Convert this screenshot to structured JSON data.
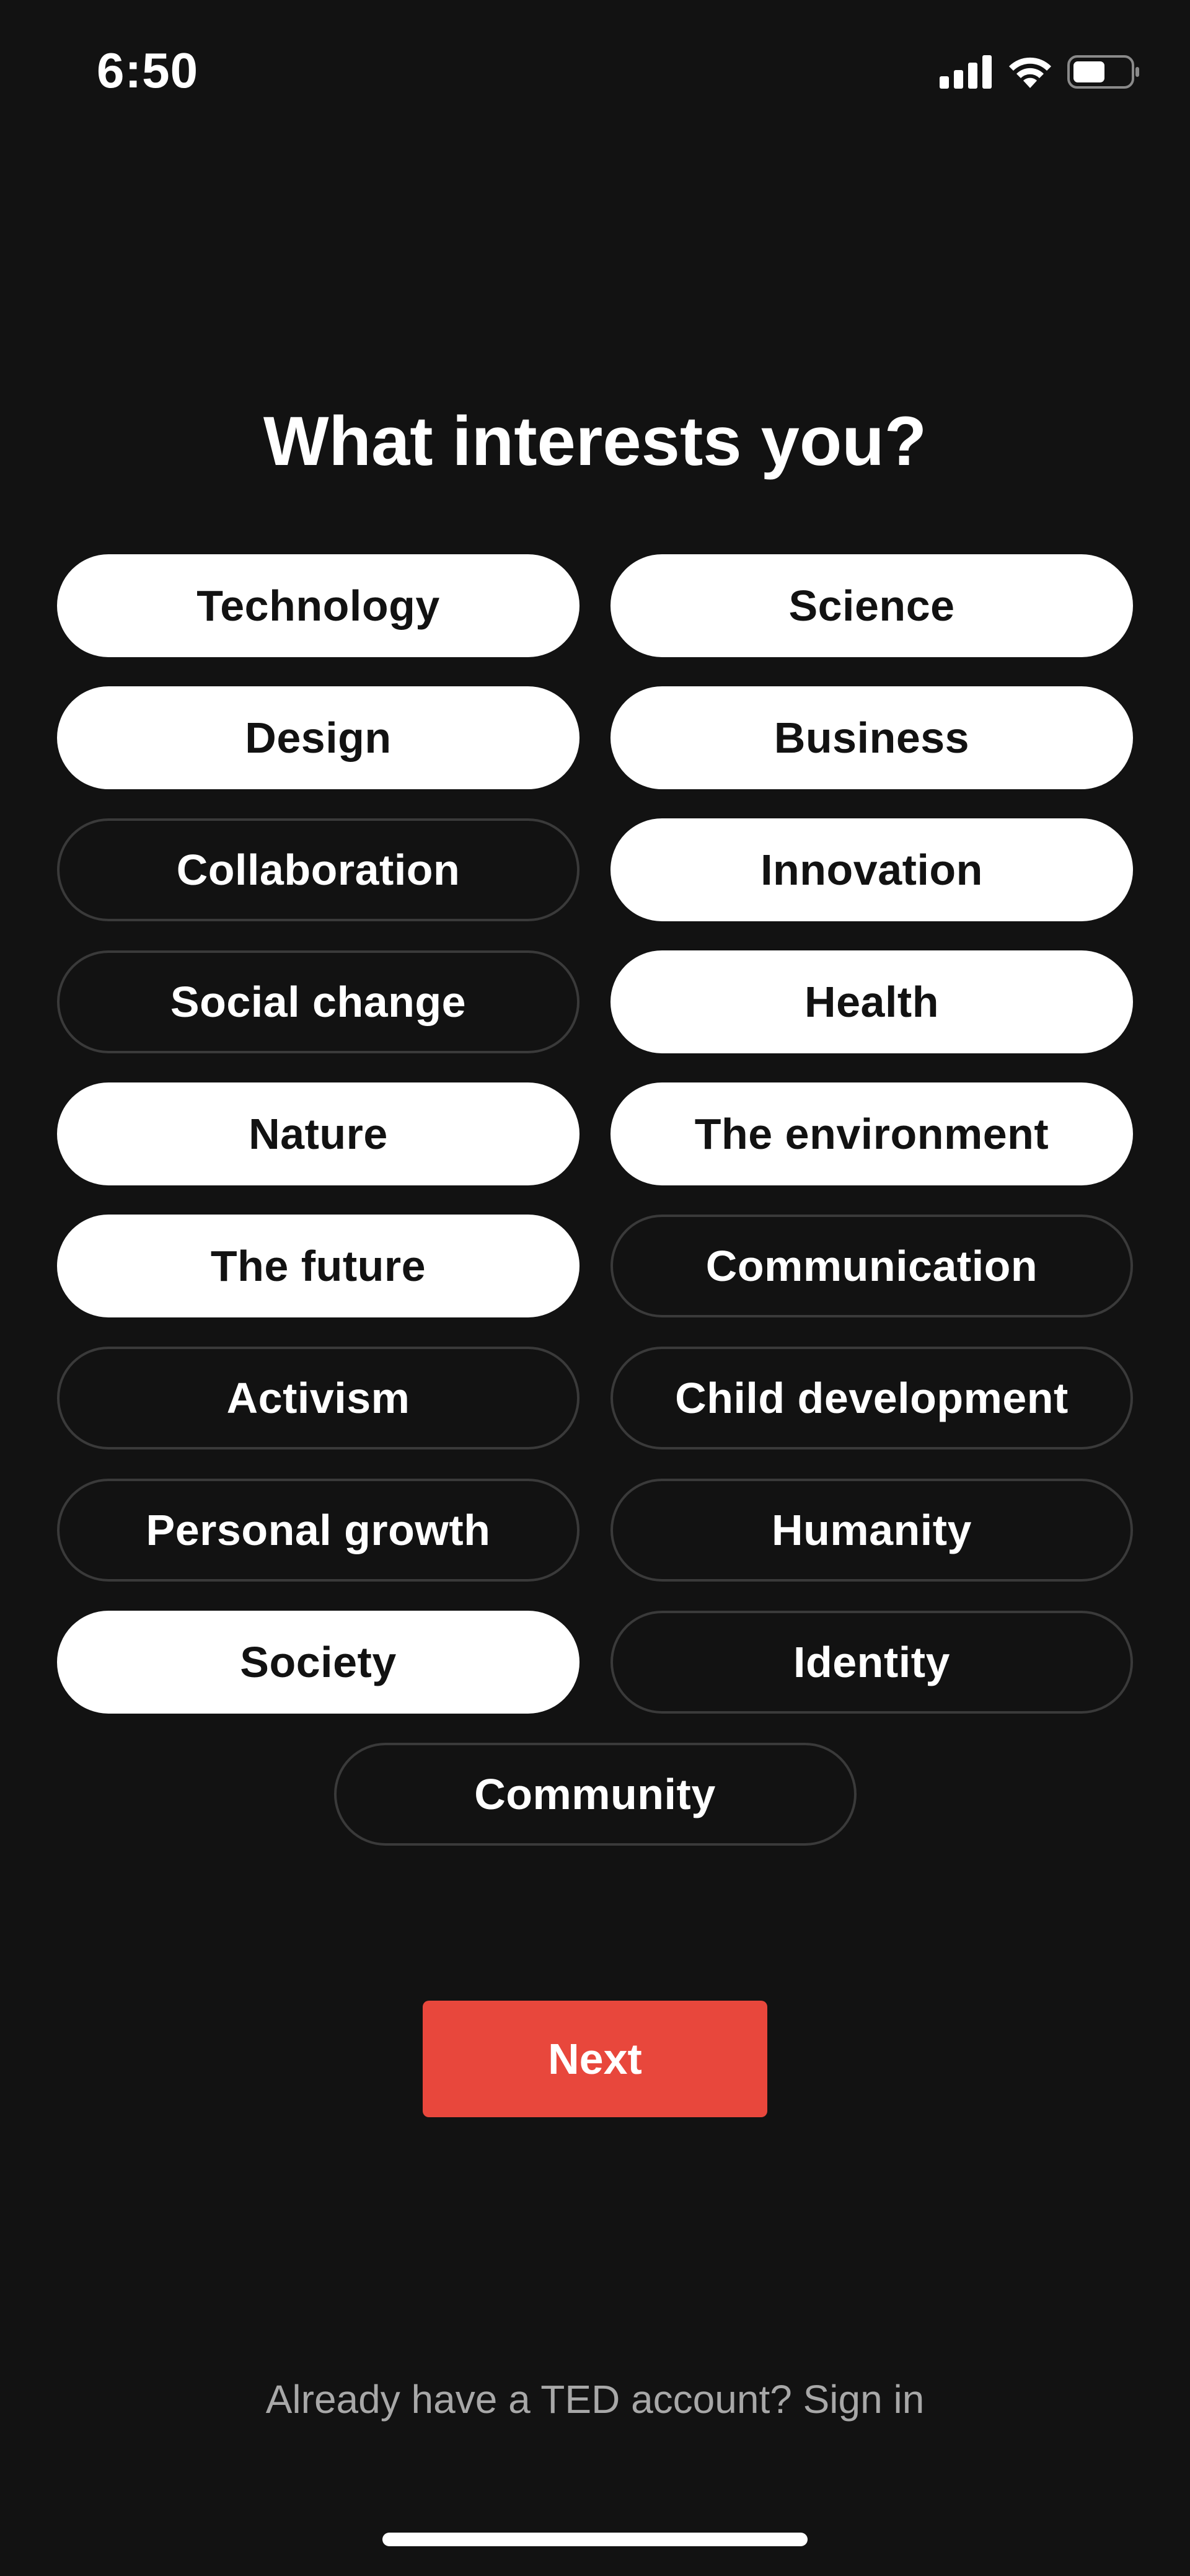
{
  "status_bar": {
    "time": "6:50",
    "icons": [
      "signal-icon",
      "wifi-icon",
      "battery-icon"
    ]
  },
  "title": "What interests you?",
  "colors": {
    "background": "#121212",
    "chip_selected_bg": "#ffffff",
    "chip_unselected_border": "#3a3a3a",
    "accent": "#e8473c",
    "muted_text": "#a8a8a8"
  },
  "chips": [
    {
      "label": "Technology",
      "selected": true
    },
    {
      "label": "Science",
      "selected": true
    },
    {
      "label": "Design",
      "selected": true
    },
    {
      "label": "Business",
      "selected": true
    },
    {
      "label": "Collaboration",
      "selected": false
    },
    {
      "label": "Innovation",
      "selected": true
    },
    {
      "label": "Social change",
      "selected": false
    },
    {
      "label": "Health",
      "selected": true
    },
    {
      "label": "Nature",
      "selected": true
    },
    {
      "label": "The environment",
      "selected": true
    },
    {
      "label": "The future",
      "selected": true
    },
    {
      "label": "Communication",
      "selected": false
    },
    {
      "label": "Activism",
      "selected": false
    },
    {
      "label": "Child development",
      "selected": false
    },
    {
      "label": "Personal growth",
      "selected": false
    },
    {
      "label": "Humanity",
      "selected": false
    },
    {
      "label": "Society",
      "selected": true
    },
    {
      "label": "Identity",
      "selected": false
    },
    {
      "label": "Community",
      "selected": false
    }
  ],
  "next_button": {
    "label": "Next"
  },
  "signin": {
    "prompt": "Already have a TED account?",
    "link": "Sign in"
  }
}
